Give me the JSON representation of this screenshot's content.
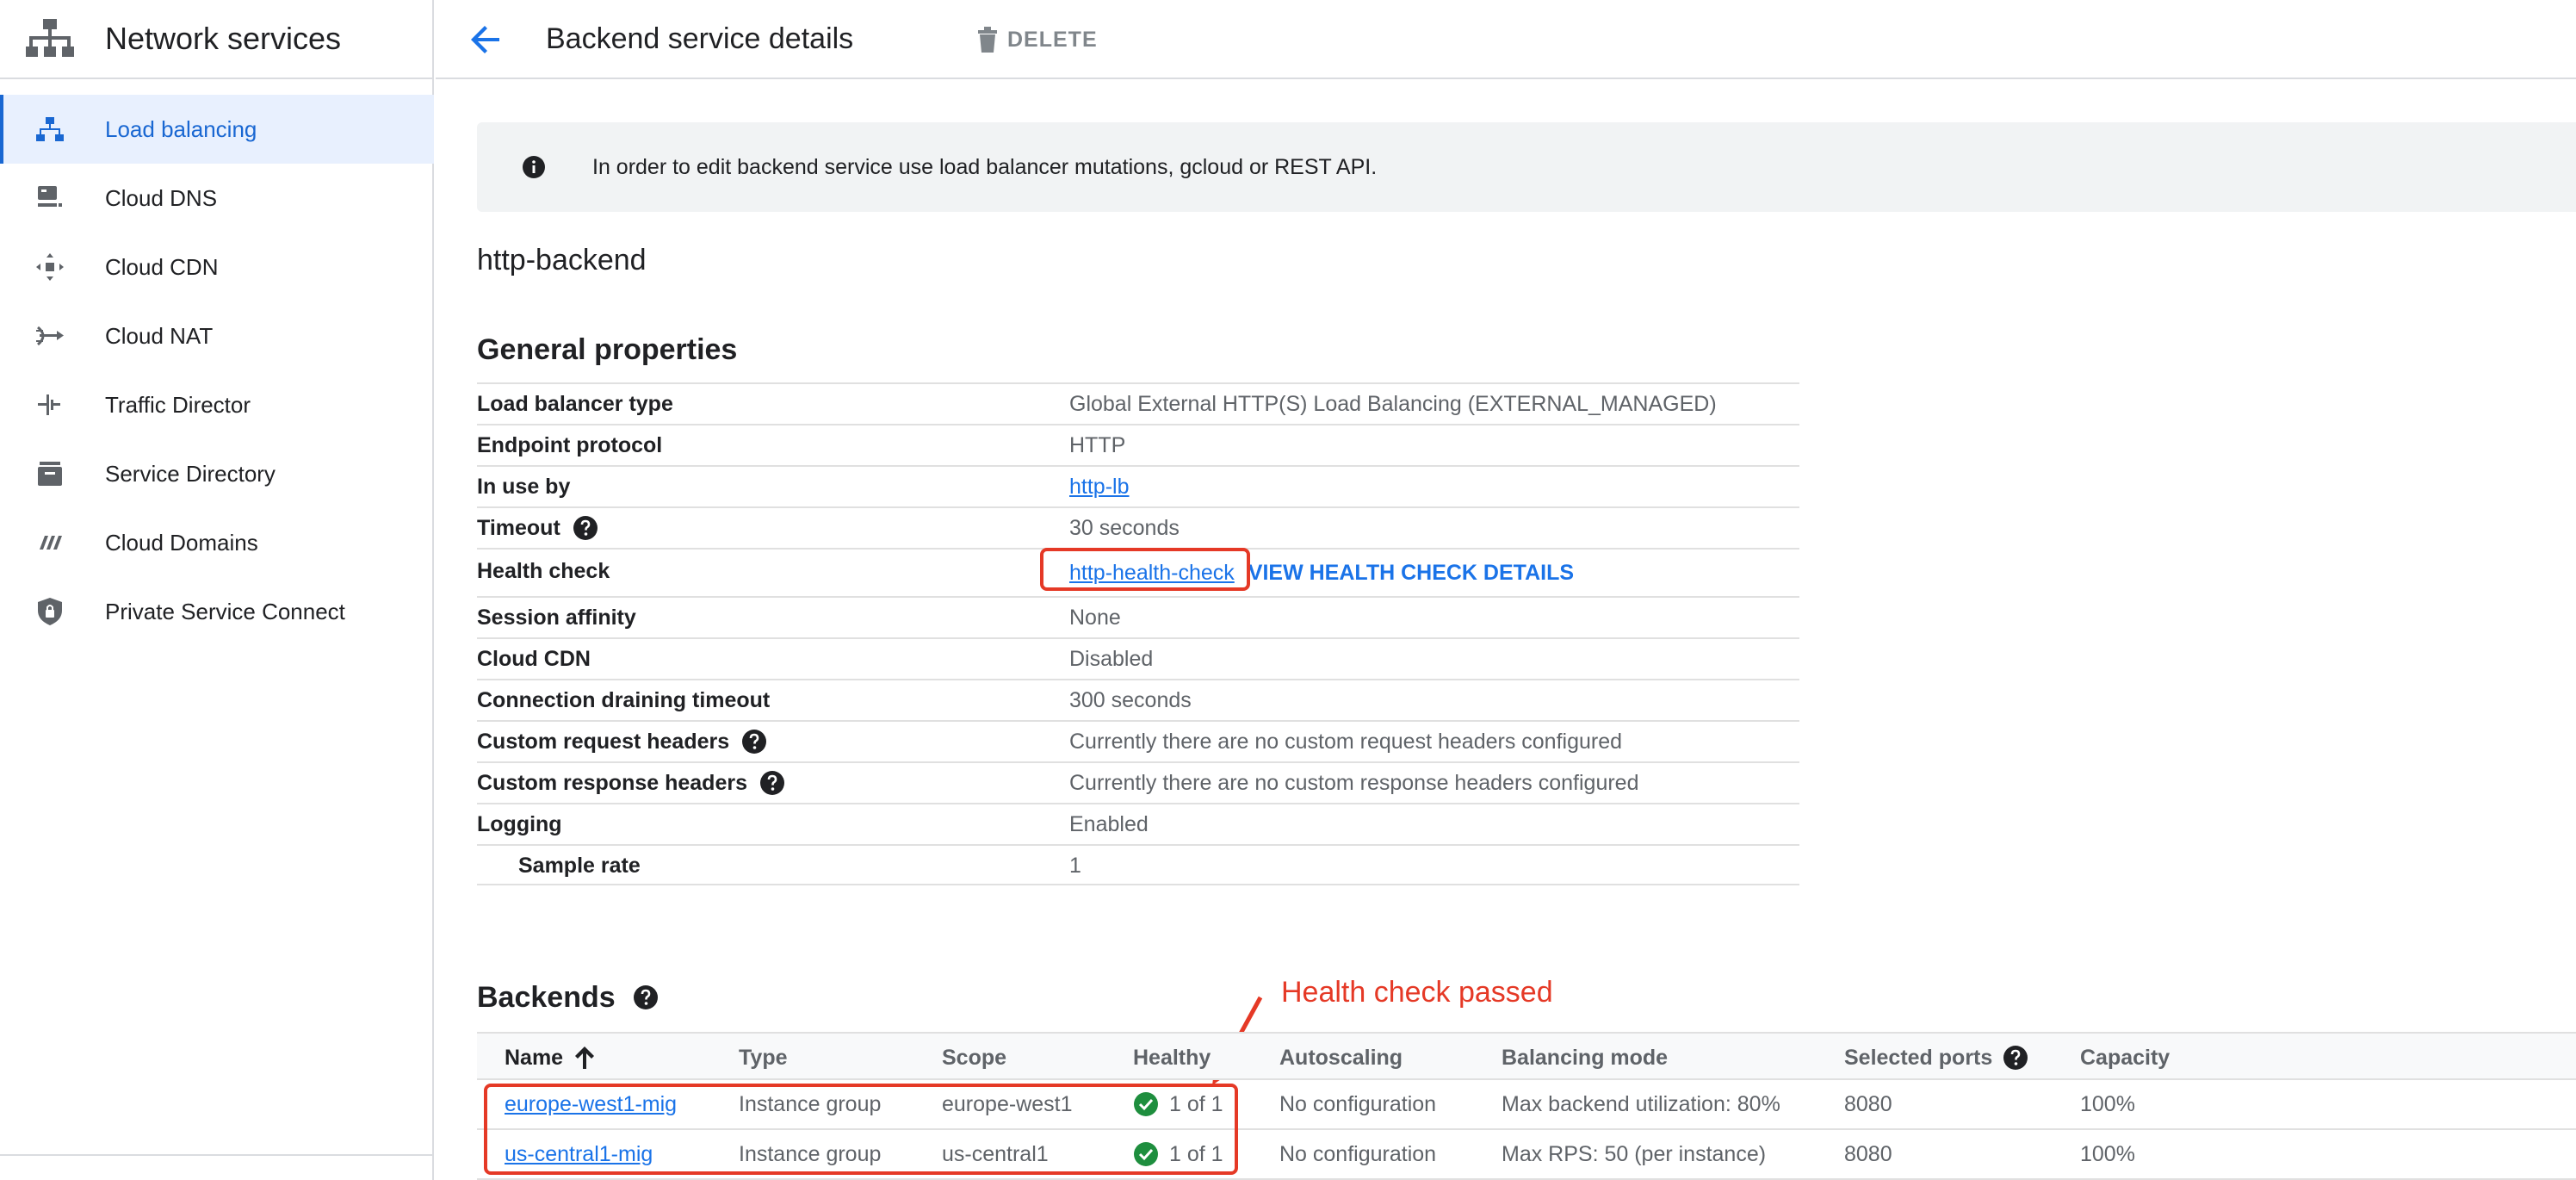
{
  "sidebar": {
    "title": "Network services",
    "items": [
      {
        "label": "Load balancing",
        "icon": "load-balancing-icon",
        "active": true
      },
      {
        "label": "Cloud DNS",
        "icon": "cloud-dns-icon"
      },
      {
        "label": "Cloud CDN",
        "icon": "cloud-cdn-icon"
      },
      {
        "label": "Cloud NAT",
        "icon": "cloud-nat-icon"
      },
      {
        "label": "Traffic Director",
        "icon": "traffic-director-icon"
      },
      {
        "label": "Service Directory",
        "icon": "service-directory-icon"
      },
      {
        "label": "Cloud Domains",
        "icon": "cloud-domains-icon"
      },
      {
        "label": "Private Service Connect",
        "icon": "private-service-connect-icon"
      }
    ]
  },
  "header": {
    "title": "Backend service details",
    "delete_label": "DELETE"
  },
  "info": {
    "text": "In order to edit backend service use load balancer mutations, gcloud or REST API."
  },
  "service_name": "http-backend",
  "general": {
    "title": "General properties",
    "rows": [
      {
        "key": "Load balancer type",
        "value": "Global External HTTP(S) Load Balancing (EXTERNAL_MANAGED)"
      },
      {
        "key": "Endpoint protocol",
        "value": "HTTP"
      },
      {
        "key": "In use by",
        "value": "http-lb"
      },
      {
        "key": "Timeout",
        "value": "30 seconds"
      },
      {
        "key": "Health check",
        "value": "http-health-check",
        "action": "VIEW HEALTH CHECK DETAILS"
      },
      {
        "key": "Session affinity",
        "value": "None"
      },
      {
        "key": "Cloud CDN",
        "value": "Disabled"
      },
      {
        "key": "Connection draining timeout",
        "value": "300 seconds"
      },
      {
        "key": "Custom request headers",
        "value": "Currently there are no custom request headers configured"
      },
      {
        "key": "Custom response headers",
        "value": "Currently there are no custom response headers configured"
      },
      {
        "key": "Logging",
        "value": "Enabled"
      },
      {
        "key": "Sample rate",
        "value": "1"
      }
    ]
  },
  "backends": {
    "title": "Backends",
    "annotation": "Health check passed",
    "columns": [
      "Name",
      "Type",
      "Scope",
      "Healthy",
      "Autoscaling",
      "Balancing mode",
      "Selected ports",
      "Capacity"
    ],
    "rows": [
      [
        "europe-west1-mig",
        "Instance group",
        "europe-west1",
        "1 of 1",
        "No configuration",
        "Max backend utilization: 80%",
        "8080",
        "100%"
      ],
      [
        "us-central1-mig",
        "Instance group",
        "us-central1",
        "1 of 1",
        "No configuration",
        "Max RPS: 50 (per instance)",
        "8080",
        "100%"
      ]
    ]
  },
  "colors": {
    "accent": "#1a73e8",
    "annotation": "#e53926",
    "healthy": "#1e8e3e"
  }
}
